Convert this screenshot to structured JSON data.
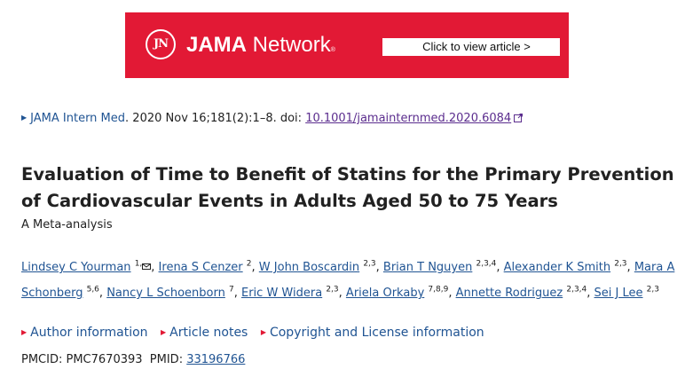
{
  "banner": {
    "logo_mark": "JN",
    "brand_bold": "JAMA",
    "brand_rest": " Network",
    "trademark": "®",
    "cta_label": "Click to view article >",
    "background_color": "#e21935"
  },
  "citation": {
    "journal": "JAMA Intern Med",
    "details": ". 2020 Nov 16;181(2):1–8. doi: ",
    "doi": "10.1001/jamainternmed.2020.6084"
  },
  "article": {
    "title": "Evaluation of Time to Benefit of Statins for the Primary Prevention of Cardiovascular Events in Adults Aged 50 to 75 Years",
    "subtitle": "A Meta-analysis"
  },
  "authors": [
    {
      "name": "Lindsey C Yourman",
      "aff": "1,"
    },
    {
      "name": "Irena S Cenzer",
      "aff": "2"
    },
    {
      "name": "W John Boscardin",
      "aff": "2,3"
    },
    {
      "name": "Brian T Nguyen",
      "aff": "2,3,4"
    },
    {
      "name": "Alexander K Smith",
      "aff": "2,3"
    },
    {
      "name": "Mara A Schonberg",
      "aff": "5,6"
    },
    {
      "name": "Nancy L Schoenborn",
      "aff": "7"
    },
    {
      "name": "Eric W Widera",
      "aff": "2,3"
    },
    {
      "name": "Ariela Orkaby",
      "aff": "7,8,9"
    },
    {
      "name": "Annette Rodriguez",
      "aff": "2,3,4"
    },
    {
      "name": "Sei J Lee",
      "aff": "2,3"
    }
  ],
  "info_links": [
    "Author information",
    "Article notes",
    "Copyright and License information"
  ],
  "ids": {
    "pmcid_label": "PMCID: ",
    "pmcid": "PMC7670393",
    "pmid_label": "PMID: ",
    "pmid": "33196766"
  },
  "colors": {
    "link": "#205493",
    "visited": "#5b2d8e",
    "accent": "#e21935"
  }
}
